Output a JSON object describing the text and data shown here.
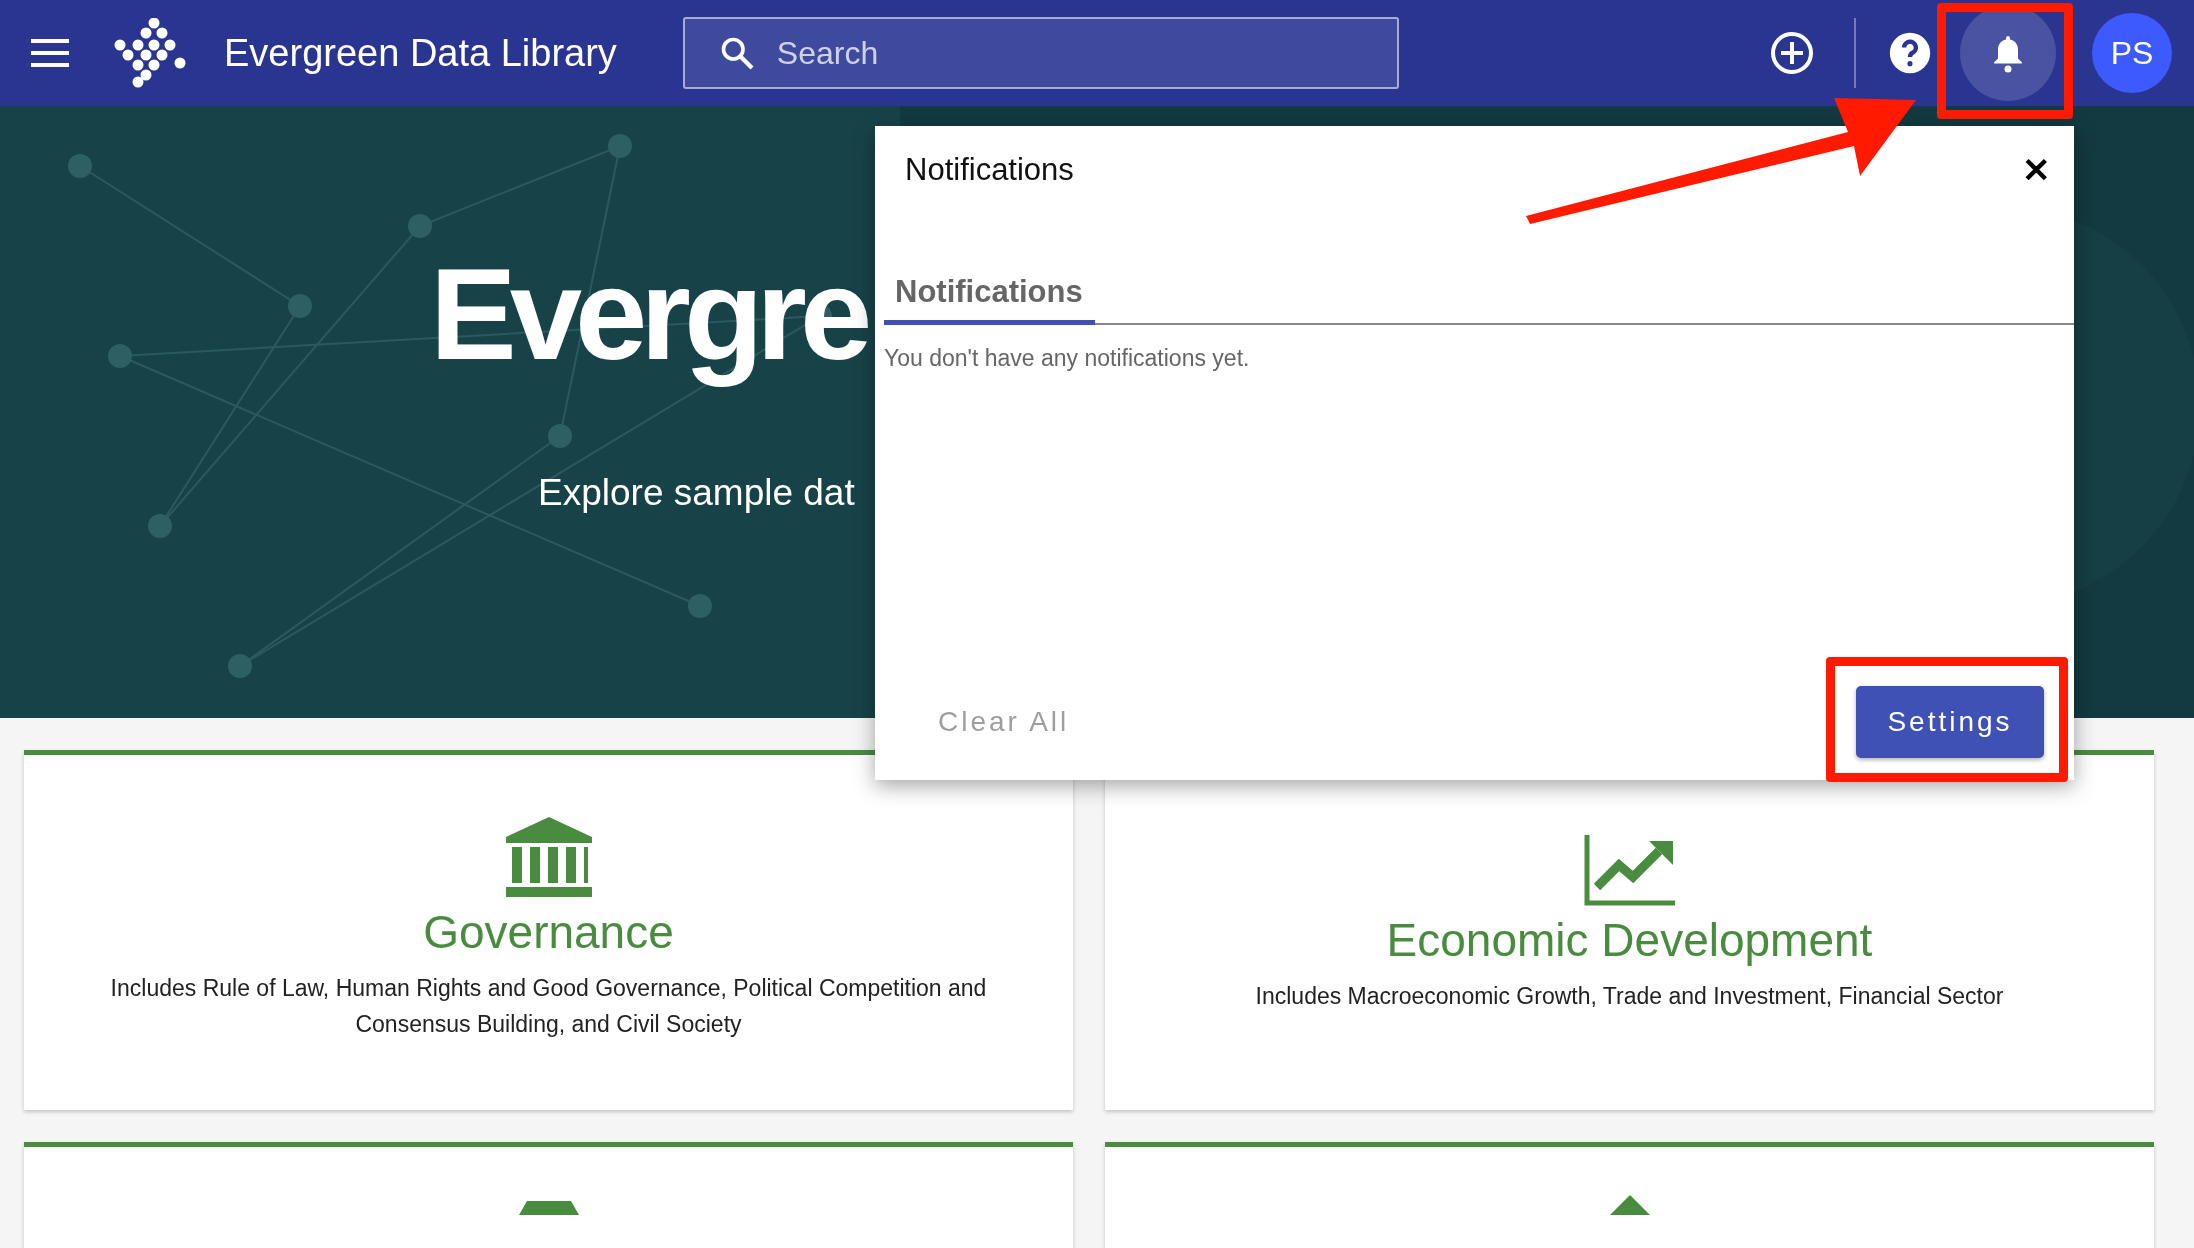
{
  "header": {
    "title": "Evergreen Data Library",
    "search": {
      "placeholder": "Search"
    },
    "avatar": "PS",
    "notifications_open": true
  },
  "hero": {
    "title": "Evergre",
    "subtitle": "Explore sample dat"
  },
  "notifications_panel": {
    "title": "Notifications",
    "close": "✕",
    "tabs": [
      {
        "label": "Notifications",
        "selected": true
      }
    ],
    "message": "You don't have any notifications yet.",
    "clear_button": {
      "label": "Clear All",
      "disabled": true
    },
    "settings_button": "Settings"
  },
  "cards": [
    {
      "kind": "full",
      "title": "Governance",
      "description": "Includes Rule of Law, Human Rights and Good Governance, Political Competition and Consensus Building, and Civil Society"
    },
    {
      "kind": "full",
      "title": "Economic Development",
      "description": "Includes Macroeconomic Growth, Trade and Investment, Financial Sector"
    },
    {
      "kind": "partial"
    },
    {
      "kind": "partial"
    }
  ]
}
